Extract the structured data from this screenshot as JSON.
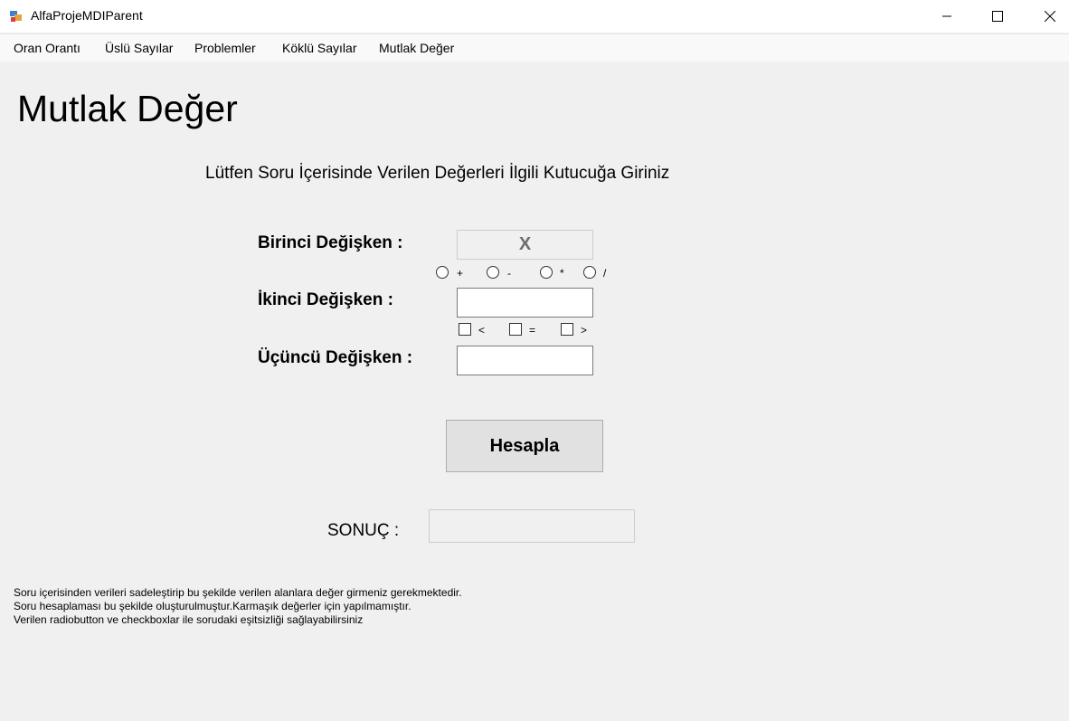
{
  "window": {
    "title": "AlfaProjeMDIParent",
    "controls": {
      "minimize_icon": "minimize-icon",
      "maximize_icon": "maximize-icon",
      "close_icon": "close-icon"
    }
  },
  "menu": {
    "items": [
      {
        "label": "Oran Orantı"
      },
      {
        "label": "Üslü Sayılar"
      },
      {
        "label": "Problemler"
      },
      {
        "label": "Köklü Sayılar"
      },
      {
        "label": "Mutlak Değer"
      }
    ]
  },
  "page": {
    "heading": "Mutlak Değer",
    "instruction": "Lütfen Soru İçerisinde Verilen Değerleri İlgili Kutucuğa Giriniz"
  },
  "form": {
    "first_label": "Birinci Değişken  :",
    "first_value": "X",
    "operators": [
      "+",
      "-",
      "*",
      "/"
    ],
    "second_label": "İkinci Değişken :",
    "second_value": "",
    "comparisons": [
      "<",
      "=",
      ">"
    ],
    "third_label": "Üçüncü Değişken :",
    "third_value": "",
    "calc_button": "Hesapla",
    "result_label": "SONUÇ :",
    "result_value": ""
  },
  "notes": [
    "Soru içerisinden verileri sadeleştirip bu şekilde verilen alanlara değer girmeniz gerekmektedir.",
    "Soru hesaplaması bu şekilde oluşturulmuştur.Karmaşık değerler için yapılmamıştır.",
    "Verilen radiobutton ve checkboxlar ile sorudaki eşitsizliği sağlayabilirsiniz"
  ],
  "colors": {
    "background": "#f0f0f0",
    "titlebar": "#ffffff",
    "menubar": "#f9f9f9",
    "button": "#e1e1e1"
  }
}
